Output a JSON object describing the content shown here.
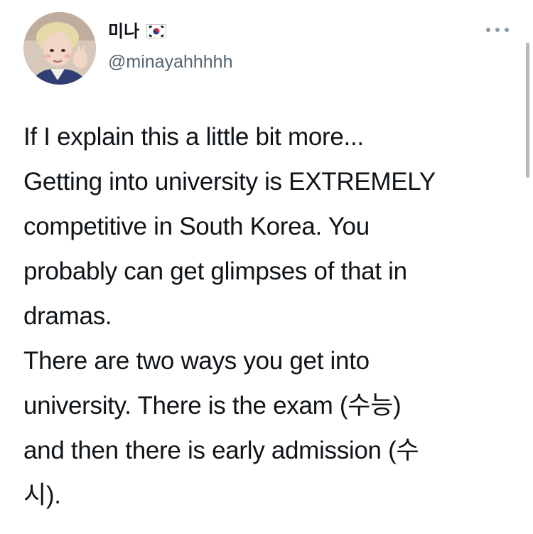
{
  "user": {
    "display_name": "미나",
    "flag_icon": "south-korea-flag-icon",
    "handle": "@minayahhhhh"
  },
  "menu": {
    "icon": "more-options-icon"
  },
  "tweet": {
    "lines": [
      "If I explain this a little bit more...",
      "Getting into university is EXTREMELY",
      "competitive in South Korea. You",
      "probably can get glimpses of that in",
      "dramas.",
      "There are two ways you get into",
      "university. There is the exam (수능)",
      "and then there is early admission (수",
      "시)."
    ]
  },
  "colors": {
    "text": "#0f1419",
    "secondary": "#536471",
    "background": "#ffffff"
  }
}
